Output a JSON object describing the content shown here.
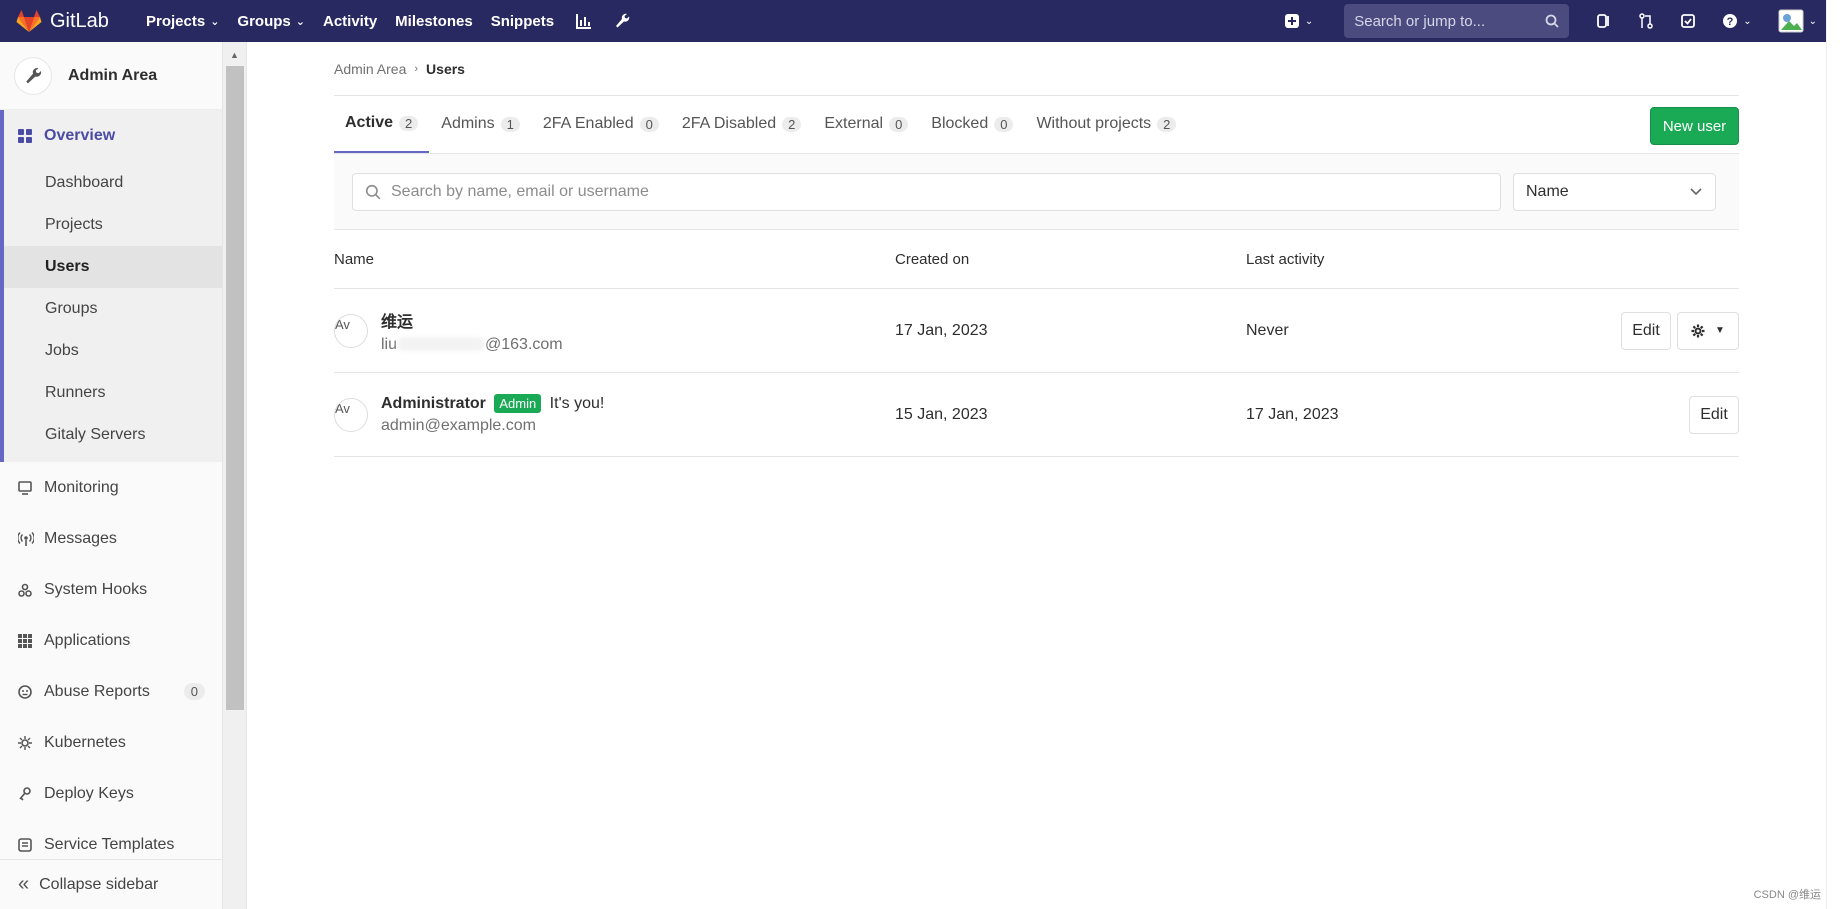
{
  "topbar": {
    "logo_text": "GitLab",
    "nav": [
      {
        "label": "Projects",
        "dropdown": true
      },
      {
        "label": "Groups",
        "dropdown": true
      },
      {
        "label": "Activity",
        "dropdown": false
      },
      {
        "label": "Milestones",
        "dropdown": false
      },
      {
        "label": "Snippets",
        "dropdown": false
      }
    ],
    "search_placeholder": "Search or jump to...",
    "colors": {
      "bg": "#292961",
      "accent": "#fc6d26"
    }
  },
  "sidebar": {
    "title": "Admin Area",
    "overview": {
      "label": "Overview",
      "subitems": [
        "Dashboard",
        "Projects",
        "Users",
        "Groups",
        "Jobs",
        "Runners",
        "Gitaly Servers"
      ],
      "active": "Users"
    },
    "items": [
      {
        "label": "Monitoring",
        "icon": "monitor-icon"
      },
      {
        "label": "Messages",
        "icon": "broadcast-icon"
      },
      {
        "label": "System Hooks",
        "icon": "hook-icon"
      },
      {
        "label": "Applications",
        "icon": "apps-grid-icon"
      },
      {
        "label": "Abuse Reports",
        "icon": "smiley-icon",
        "badge": "0"
      },
      {
        "label": "Kubernetes",
        "icon": "kubernetes-icon"
      },
      {
        "label": "Deploy Keys",
        "icon": "key-icon"
      },
      {
        "label": "Service Templates",
        "icon": "template-icon"
      }
    ],
    "collapse_label": "Collapse sidebar"
  },
  "breadcrumb": {
    "parent": "Admin Area",
    "current": "Users"
  },
  "tabs": [
    {
      "label": "Active",
      "count": "2",
      "active": true
    },
    {
      "label": "Admins",
      "count": "1",
      "active": false
    },
    {
      "label": "2FA Enabled",
      "count": "0",
      "active": false
    },
    {
      "label": "2FA Disabled",
      "count": "2",
      "active": false
    },
    {
      "label": "External",
      "count": "0",
      "active": false
    },
    {
      "label": "Blocked",
      "count": "0",
      "active": false
    },
    {
      "label": "Without projects",
      "count": "2",
      "active": false
    }
  ],
  "new_user_label": "New user",
  "filter": {
    "search_placeholder": "Search by name, email or username",
    "sort_value": "Name"
  },
  "table": {
    "headers": {
      "name": "Name",
      "created": "Created on",
      "last": "Last activity"
    },
    "rows": [
      {
        "avatar_alt": "Av",
        "name": "维运",
        "email_prefix": "liu",
        "email_suffix": "@163.com",
        "created": "17 Jan, 2023",
        "last_activity": "Never",
        "edit_label": "Edit",
        "has_gear": true
      },
      {
        "avatar_alt": "Av",
        "name": "Administrator",
        "badge": "Admin",
        "note": "It's you!",
        "email": "admin@example.com",
        "created": "15 Jan, 2023",
        "last_activity": "17 Jan, 2023",
        "edit_label": "Edit",
        "has_gear": false
      }
    ]
  },
  "watermark": "CSDN @维运"
}
